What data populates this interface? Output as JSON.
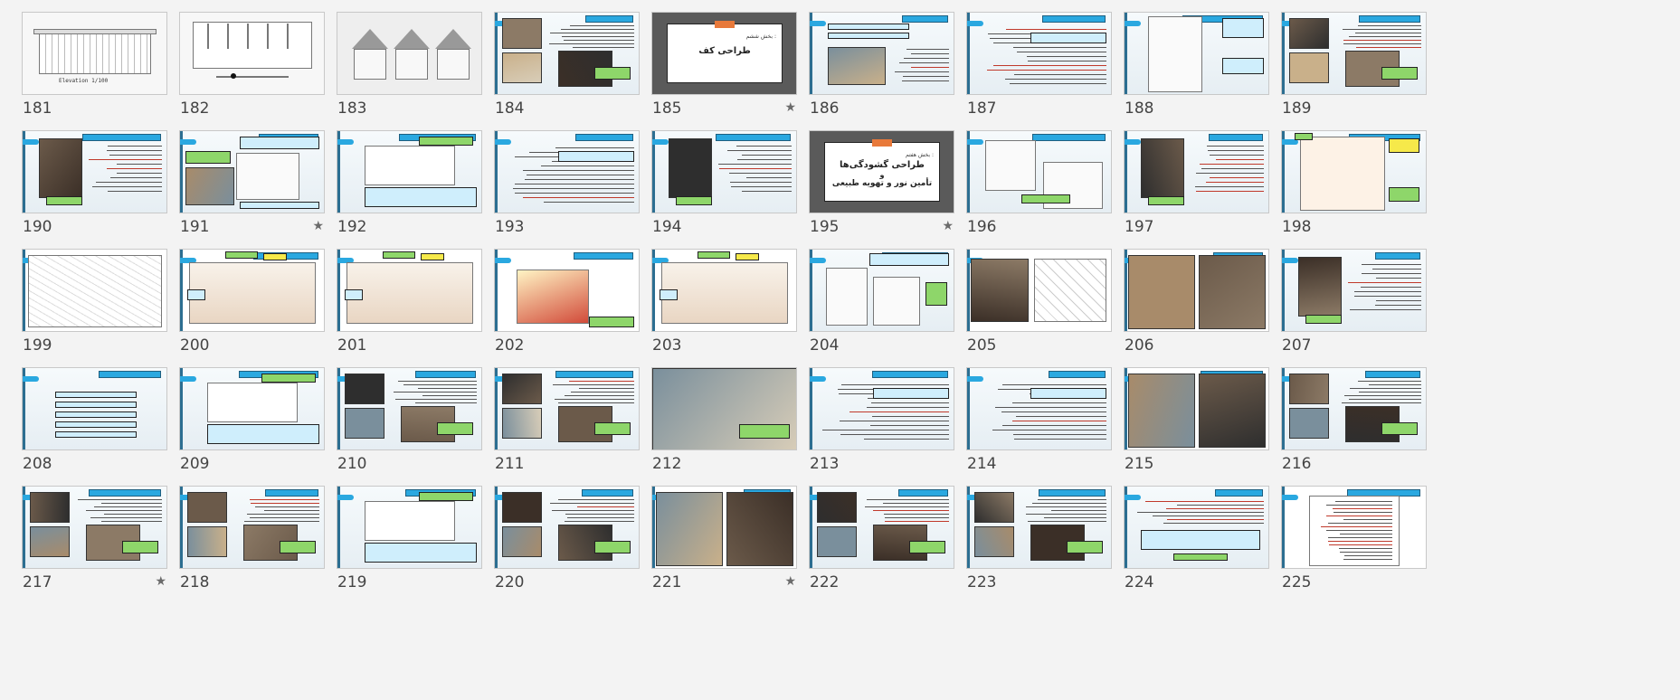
{
  "slides": [
    {
      "num": "181",
      "starred": false,
      "kind": "elevation"
    },
    {
      "num": "182",
      "starred": false,
      "kind": "plan"
    },
    {
      "num": "183",
      "starred": false,
      "kind": "section"
    },
    {
      "num": "184",
      "starred": false,
      "kind": "photos-text"
    },
    {
      "num": "185",
      "starred": true,
      "kind": "title",
      "title": "طراحی کف",
      "subtitle": "بخش ششم :"
    },
    {
      "num": "186",
      "starred": false,
      "kind": "diagram-text"
    },
    {
      "num": "187",
      "starred": false,
      "kind": "text"
    },
    {
      "num": "188",
      "starred": false,
      "kind": "sections-text"
    },
    {
      "num": "189",
      "starred": false,
      "kind": "photos-text"
    },
    {
      "num": "190",
      "starred": false,
      "kind": "photo-text"
    },
    {
      "num": "191",
      "starred": true,
      "kind": "photo-plan-text"
    },
    {
      "num": "192",
      "starred": false,
      "kind": "section-text"
    },
    {
      "num": "193",
      "starred": false,
      "kind": "text"
    },
    {
      "num": "194",
      "starred": false,
      "kind": "photo-text"
    },
    {
      "num": "195",
      "starred": true,
      "kind": "title",
      "title": "طراحی گشودگی‌ها",
      "title2": "و",
      "title3": "تأمین نور و تهویه طبیعی",
      "subtitle": "بخش هفتم :"
    },
    {
      "num": "196",
      "starred": false,
      "kind": "diagrams-text"
    },
    {
      "num": "197",
      "starred": false,
      "kind": "photo-text"
    },
    {
      "num": "198",
      "starred": false,
      "kind": "ventilation"
    },
    {
      "num": "199",
      "starred": false,
      "kind": "perspective"
    },
    {
      "num": "200",
      "starred": false,
      "kind": "section-color"
    },
    {
      "num": "201",
      "starred": false,
      "kind": "section-color"
    },
    {
      "num": "202",
      "starred": false,
      "kind": "natural-ventilation"
    },
    {
      "num": "203",
      "starred": false,
      "kind": "section-color"
    },
    {
      "num": "204",
      "starred": false,
      "kind": "details-text"
    },
    {
      "num": "205",
      "starred": false,
      "kind": "photo-details"
    },
    {
      "num": "206",
      "starred": false,
      "kind": "photos"
    },
    {
      "num": "207",
      "starred": false,
      "kind": "photo-text"
    },
    {
      "num": "208",
      "starred": false,
      "kind": "list-boxes"
    },
    {
      "num": "209",
      "starred": false,
      "kind": "section-text"
    },
    {
      "num": "210",
      "starred": false,
      "kind": "photos-text"
    },
    {
      "num": "211",
      "starred": false,
      "kind": "photos-text"
    },
    {
      "num": "212",
      "starred": false,
      "kind": "full-photo"
    },
    {
      "num": "213",
      "starred": false,
      "kind": "text"
    },
    {
      "num": "214",
      "starred": false,
      "kind": "text"
    },
    {
      "num": "215",
      "starred": false,
      "kind": "photos"
    },
    {
      "num": "216",
      "starred": false,
      "kind": "photos-text"
    },
    {
      "num": "217",
      "starred": true,
      "kind": "photos-text"
    },
    {
      "num": "218",
      "starred": false,
      "kind": "photos-text"
    },
    {
      "num": "219",
      "starred": false,
      "kind": "section-text"
    },
    {
      "num": "220",
      "starred": false,
      "kind": "photos-text"
    },
    {
      "num": "221",
      "starred": true,
      "kind": "photos"
    },
    {
      "num": "222",
      "starred": false,
      "kind": "photos-text"
    },
    {
      "num": "223",
      "starred": false,
      "kind": "photos-text"
    },
    {
      "num": "224",
      "starred": false,
      "kind": "text-boxes"
    },
    {
      "num": "225",
      "starred": false,
      "kind": "document"
    }
  ],
  "star_glyph": "★",
  "colors": {
    "accent_blue": "#2aa8e0",
    "box_blue": "#cfeefc",
    "box_green": "#8ed66a",
    "box_yellow": "#f6e94a",
    "title_slide_bg": "#5a5a5a",
    "title_slide_cap": "#e8793a"
  },
  "slide_181_caption": "Elevation 1/100"
}
